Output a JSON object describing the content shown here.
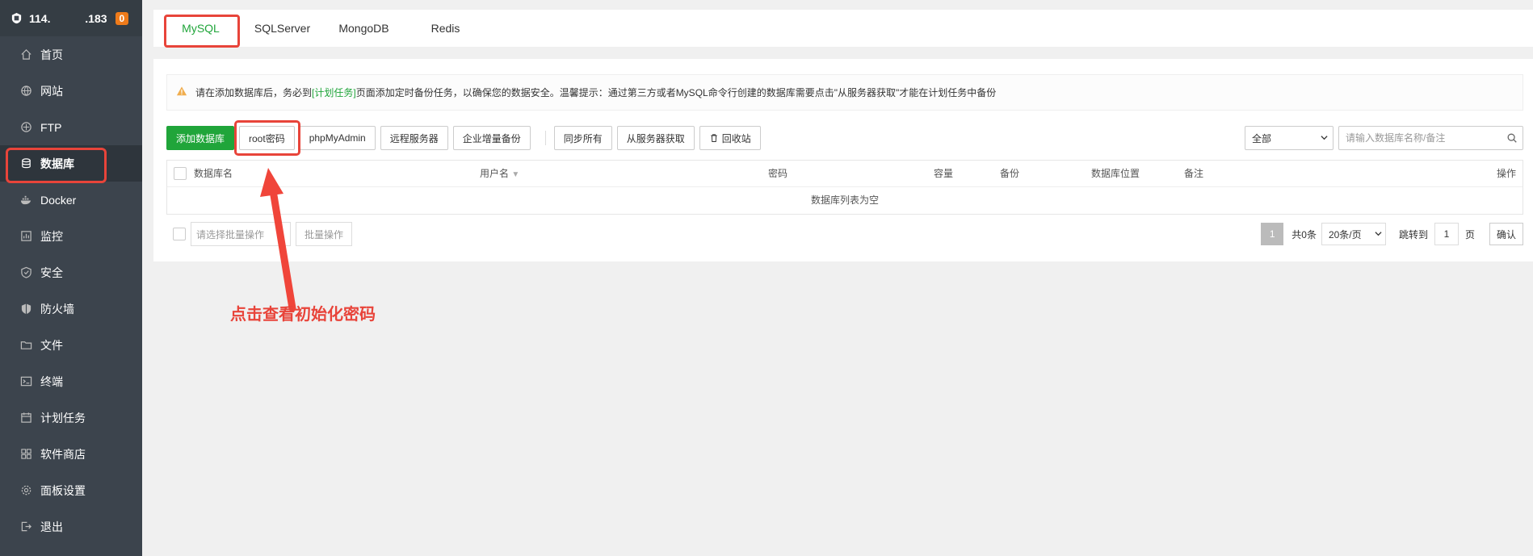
{
  "sidebar": {
    "ip": "114.           .183",
    "badge": "0",
    "items": [
      {
        "label": "首页",
        "icon": "home-icon"
      },
      {
        "label": "网站",
        "icon": "globe-icon"
      },
      {
        "label": "FTP",
        "icon": "ftp-icon"
      },
      {
        "label": "数据库",
        "icon": "database-icon"
      },
      {
        "label": "Docker",
        "icon": "docker-icon"
      },
      {
        "label": "监控",
        "icon": "monitor-icon"
      },
      {
        "label": "安全",
        "icon": "shield-icon"
      },
      {
        "label": "防火墙",
        "icon": "firewall-icon"
      },
      {
        "label": "文件",
        "icon": "folder-icon"
      },
      {
        "label": "终端",
        "icon": "terminal-icon"
      },
      {
        "label": "计划任务",
        "icon": "calendar-icon"
      },
      {
        "label": "软件商店",
        "icon": "apps-icon"
      },
      {
        "label": "面板设置",
        "icon": "gear-icon"
      },
      {
        "label": "退出",
        "icon": "logout-icon"
      }
    ]
  },
  "tabs": [
    "MySQL",
    "SQLServer",
    "MongoDB",
    "Redis"
  ],
  "notice": {
    "pre": "请在添加数据库后，务必到",
    "link": "[计划任务]",
    "post": "页面添加定时备份任务，以确保您的数据安全。温馨提示：通过第三方或者MySQL命令行创建的数据库需要点击\"从服务器获取\"才能在计划任务中备份"
  },
  "toolbar": {
    "add": "添加数据库",
    "root": "root密码",
    "pma": "phpMyAdmin",
    "remote": "远程服务器",
    "incr": "企业增量备份",
    "sync": "同步所有",
    "fetch": "从服务器获取",
    "recycle": "回收站"
  },
  "filter": {
    "select": "全部",
    "placeholder": "请输入数据库名称/备注"
  },
  "table": {
    "headers": [
      "数据库名",
      "用户名",
      "密码",
      "容量",
      "备份",
      "数据库位置",
      "备注",
      "操作"
    ],
    "empty": "数据库列表为空"
  },
  "footer": {
    "batch_placeholder": "请选择批量操作",
    "batch_btn": "批量操作",
    "page": "1",
    "total": "共0条",
    "size": "20条/页",
    "jump": "跳转到",
    "jump_val": "1",
    "page_unit": "页",
    "confirm": "确认"
  },
  "annotation": "点击查看初始化密码",
  "colors": {
    "accent": "#20a53a",
    "highlight": "#e8443a",
    "sidebar": "#3c444d"
  }
}
